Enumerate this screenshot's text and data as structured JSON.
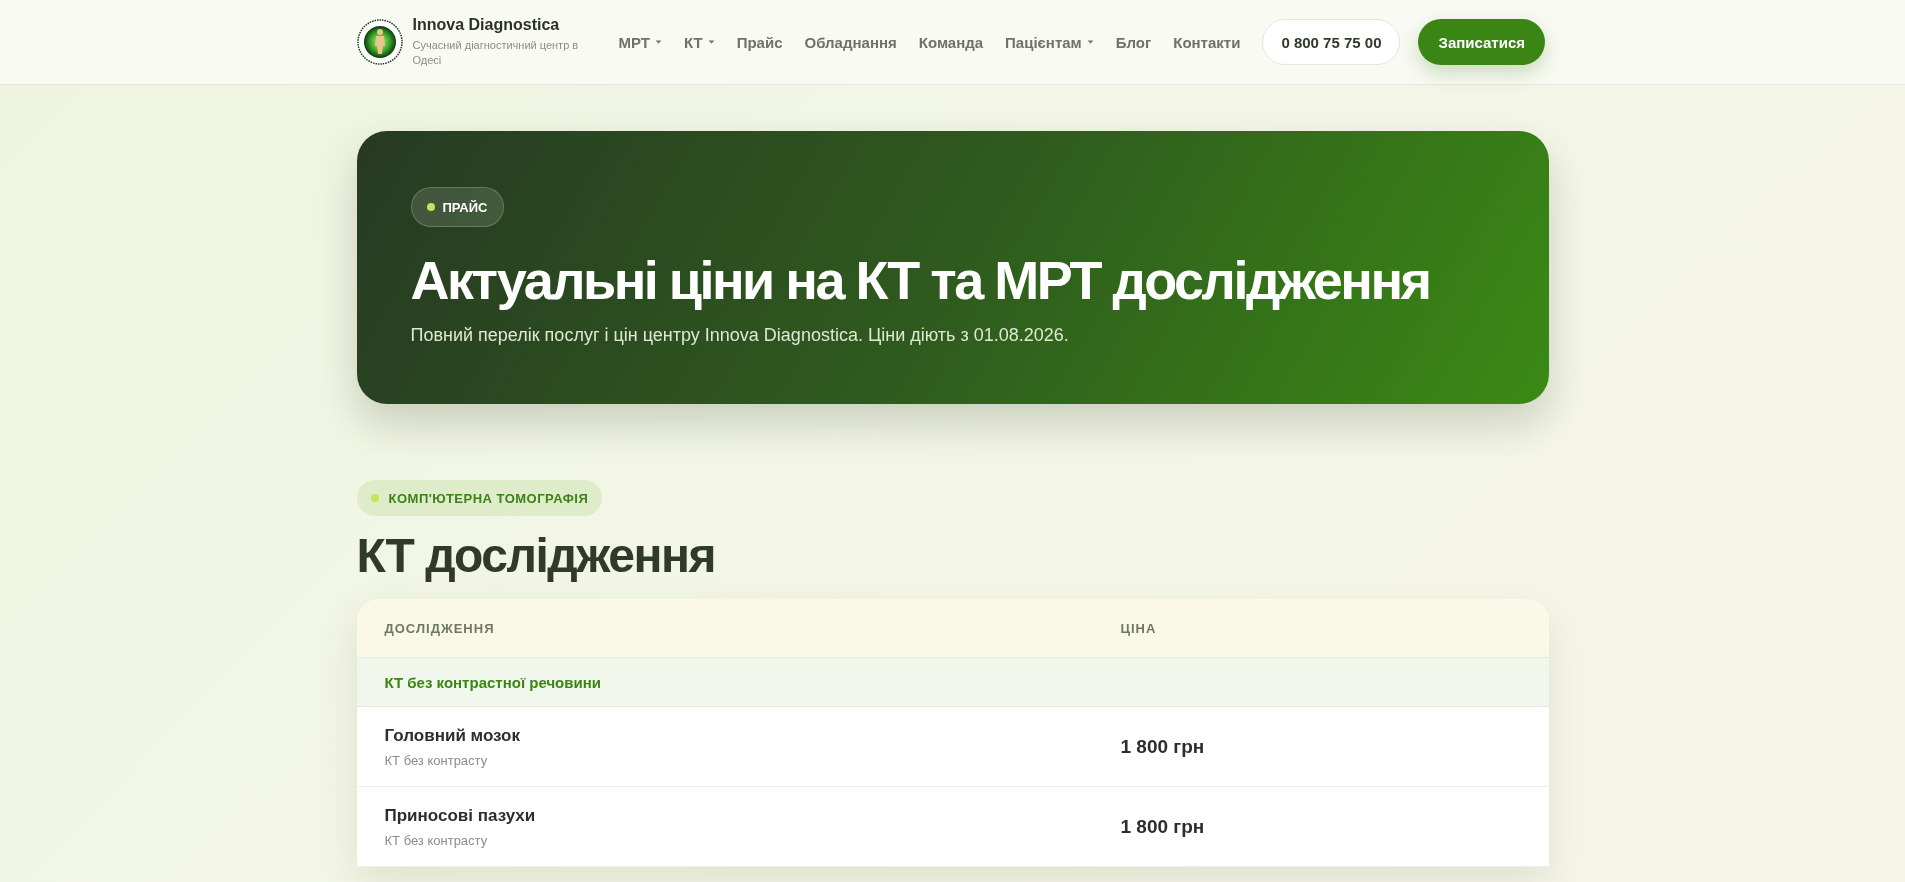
{
  "header": {
    "brand": {
      "name": "Innova Diagnostica",
      "tagline": "Сучасний діагностичний центр в Одесі"
    },
    "nav": [
      {
        "label": "МРТ",
        "dropdown": true
      },
      {
        "label": "КТ",
        "dropdown": true
      },
      {
        "label": "Прайс",
        "dropdown": false
      },
      {
        "label": "Обладнання",
        "dropdown": false
      },
      {
        "label": "Команда",
        "dropdown": false
      },
      {
        "label": "Пацієнтам",
        "dropdown": true
      },
      {
        "label": "Блог",
        "dropdown": false
      },
      {
        "label": "Контакти",
        "dropdown": false
      }
    ],
    "phone": "0 800 75 75 00",
    "cta": "Записатися"
  },
  "hero": {
    "badge": "ПРАЙС",
    "title": "Актуальні ціни на КТ та МРТ дослідження",
    "subtitle": "Повний перелік послуг і цін центру Innova Diagnostica. Ціни діють з 01.08.2026."
  },
  "section": {
    "badge": "КОМП'ЮТЕРНА ТОМОГРАФІЯ",
    "title": "КТ дослідження",
    "table": {
      "columns": [
        "ДОСЛІДЖЕННЯ",
        "ЦІНА"
      ],
      "groups": [
        {
          "title": "КТ без контрастної речовини",
          "rows": [
            {
              "name": "Головний мозок",
              "note": "КТ без контрасту",
              "price": "1 800 грн"
            },
            {
              "name": "Приносові пазухи",
              "note": "КТ без контрасту",
              "price": "1 800 грн"
            }
          ]
        }
      ]
    }
  }
}
